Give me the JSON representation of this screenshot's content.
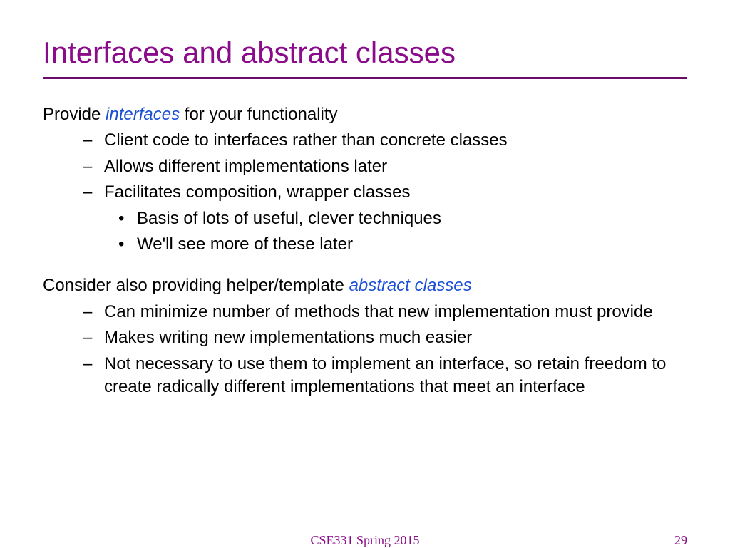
{
  "title": "Interfaces and abstract classes",
  "para1": {
    "pre": "Provide ",
    "em": "interfaces",
    "post": " for your functionality"
  },
  "bullets1": {
    "b0": "Client code to interfaces rather than concrete classes",
    "b1": "Allows different implementations later",
    "b2": "Facilitates composition, wrapper classes",
    "sub": {
      "s0": "Basis of lots of useful, clever techniques",
      "s1": "We'll see more of these later"
    }
  },
  "para2": {
    "pre": "Consider also providing helper/template ",
    "em": "abstract classes"
  },
  "bullets2": {
    "b0": "Can minimize number of methods that new implementation must provide",
    "b1": "Makes writing new implementations much easier",
    "b2": "Not necessary to use them to implement an interface, so retain freedom to create radically different implementations that meet an interface"
  },
  "footer": {
    "course": "CSE331 Spring 2015",
    "page": "29"
  }
}
